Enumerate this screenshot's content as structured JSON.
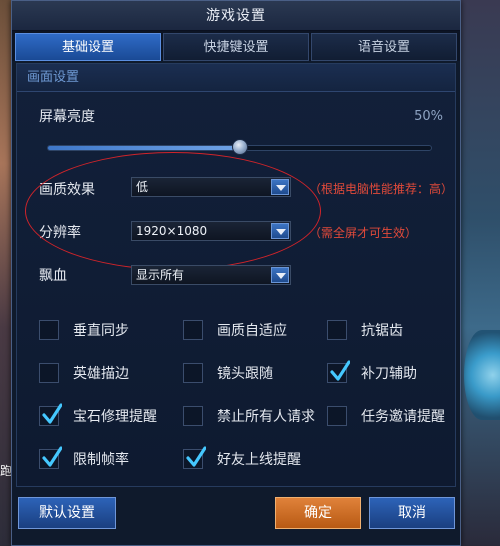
{
  "window": {
    "title": "游戏设置"
  },
  "tabs": [
    {
      "label": "基础设置",
      "active": true
    },
    {
      "label": "快捷键设置",
      "active": false
    },
    {
      "label": "语音设置",
      "active": false
    }
  ],
  "section": {
    "title": "画面设置"
  },
  "brightness": {
    "label": "屏幕亮度",
    "value_text": "50%",
    "value": 0.5
  },
  "quality": {
    "label": "画质效果",
    "value": "低",
    "hint": "（根据电脑性能推荐：高）"
  },
  "resolution": {
    "label": "分辨率",
    "value": "1920×1080",
    "hint": "（需全屏才可生效）"
  },
  "floating_blood": {
    "label": "飘血",
    "value": "显示所有"
  },
  "checkboxes": [
    {
      "label": "垂直同步",
      "checked": false
    },
    {
      "label": "画质自适应",
      "checked": false
    },
    {
      "label": "抗锯齿",
      "checked": false
    },
    {
      "label": "英雄描边",
      "checked": false
    },
    {
      "label": "镜头跟随",
      "checked": false
    },
    {
      "label": "补刀辅助",
      "checked": true
    },
    {
      "label": "宝石修理提醒",
      "checked": true
    },
    {
      "label": "禁止所有人请求",
      "checked": false
    },
    {
      "label": "任务邀请提醒",
      "checked": false
    },
    {
      "label": "限制帧率",
      "checked": true
    },
    {
      "label": "好友上线提醒",
      "checked": true
    }
  ],
  "buttons": {
    "default": "默认设置",
    "confirm": "确定",
    "cancel": "取消"
  },
  "background": {
    "left_text": "跑"
  },
  "colors": {
    "accent": "#2f6bc7",
    "hint": "#e04a3a",
    "confirm": "#e0823a",
    "check": "#45c8ff"
  }
}
